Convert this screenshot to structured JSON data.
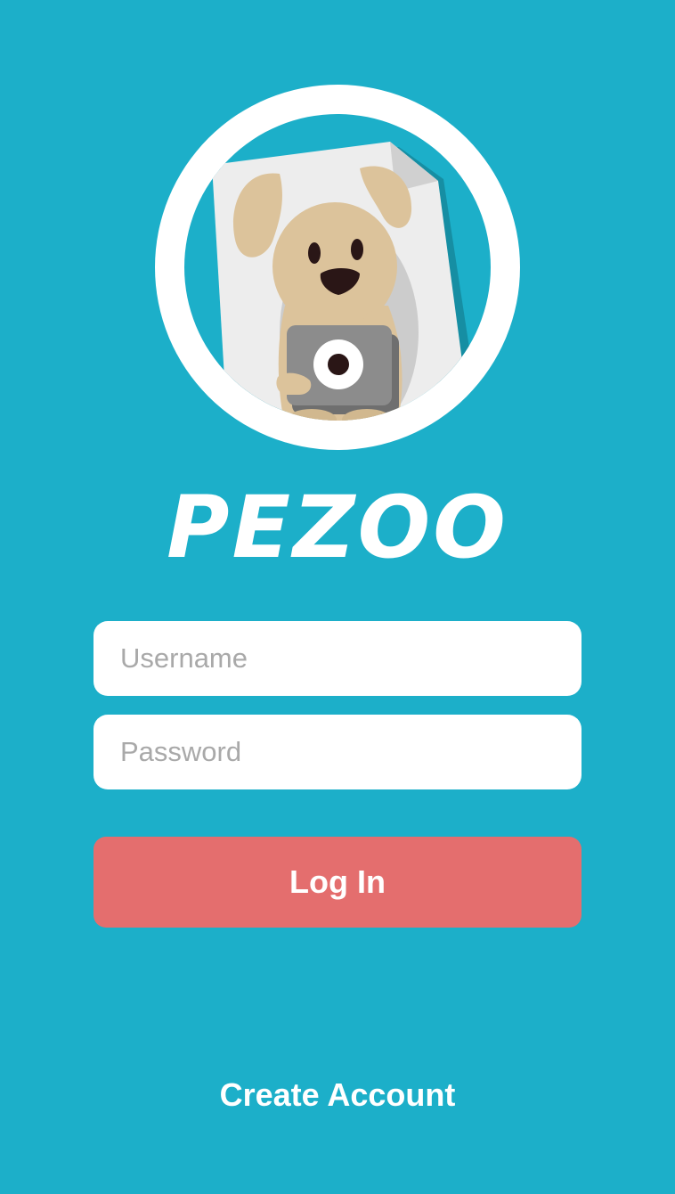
{
  "app": {
    "title": "PEZOO",
    "logo_icon": "dog-with-camera-icon"
  },
  "form": {
    "username_placeholder": "Username",
    "password_placeholder": "Password",
    "login_label": "Log In"
  },
  "footer": {
    "create_account_label": "Create Account"
  },
  "colors": {
    "background": "#1cafc9",
    "login_button": "#e46e6e",
    "field_background": "#ffffff",
    "placeholder": "#a9a9a9",
    "dog_fur": "#dcc39b",
    "camera": "#8c8c8c"
  }
}
